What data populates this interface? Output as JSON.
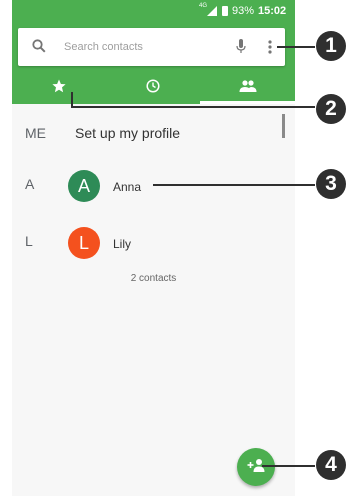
{
  "status_bar": {
    "network": "4G",
    "battery": "93%",
    "time": "15:02"
  },
  "search": {
    "placeholder": "Search contacts"
  },
  "tabs": [
    {
      "icon": "star-icon",
      "label": "Favorites"
    },
    {
      "icon": "clock-icon",
      "label": "Recent"
    },
    {
      "icon": "people-icon",
      "label": "Contacts"
    }
  ],
  "active_tab": 2,
  "profile": {
    "letter": "ME",
    "text": "Set up my profile"
  },
  "contacts": [
    {
      "section": "A",
      "initial": "A",
      "name": "Anna",
      "color": "#2e8b57"
    },
    {
      "section": "L",
      "initial": "L",
      "name": "Lily",
      "color": "#f4511e"
    }
  ],
  "contact_count": "2 contacts",
  "callouts": [
    "1",
    "2",
    "3",
    "4"
  ],
  "colors": {
    "header": "#4caf50",
    "fab": "#4caf50",
    "background": "#f7f7f7"
  }
}
